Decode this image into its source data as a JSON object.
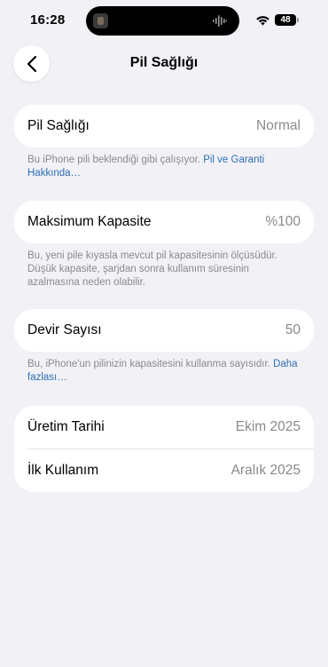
{
  "status_bar": {
    "time": "16:28",
    "battery_level": "48"
  },
  "nav": {
    "title": "Pil Sağlığı",
    "back_icon": "chevron-left-icon"
  },
  "battery_health": {
    "label": "Pil Sağlığı",
    "value": "Normal",
    "footer_text": "Bu iPhone pili beklendiği gibi çalışıyor. ",
    "footer_link": "Pil ve Garanti Hakkında…"
  },
  "max_capacity": {
    "label": "Maksimum Kapasite",
    "value": "%100",
    "footer_text": "Bu, yeni pile kıyasla mevcut pil kapasitesinin ölçüsüdür. Düşük kapasite, şarjdan sonra kullanım süresinin azalmasına neden olabilir."
  },
  "cycle_count": {
    "label": "Devir Sayısı",
    "value": "50",
    "footer_text": "Bu, iPhone'un pilinizin kapasitesini kullanma sayısıdır. ",
    "footer_link": "Daha fazlası…"
  },
  "dates": {
    "manufacture_label": "Üretim Tarihi",
    "manufacture_value": "Ekim 2025",
    "first_use_label": "İlk Kullanım",
    "first_use_value": "Aralık 2025"
  },
  "colors": {
    "background": "#f1f1f6",
    "link": "#2f6fb3",
    "secondary_text": "#8a8a8e"
  }
}
